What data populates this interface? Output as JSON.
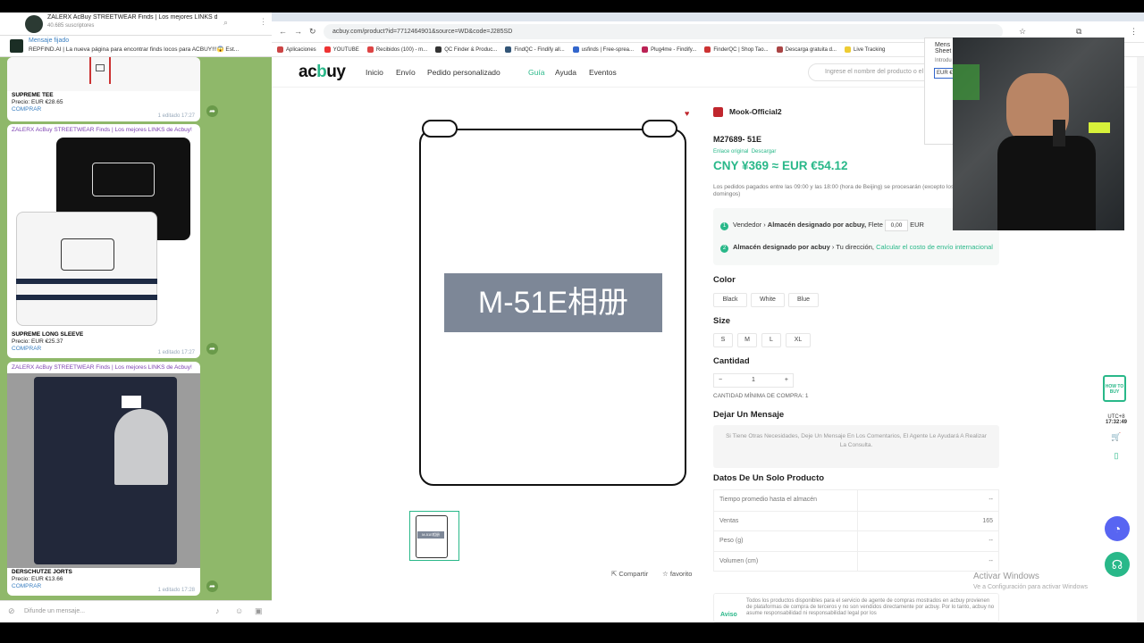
{
  "telegram": {
    "channel_title": "ZALERX AcBuy STREETWEAR Finds | Los mejores LINKS de AC...",
    "subscribers": "40.685 suscriptores",
    "pinned_label": "Mensaje fijado",
    "pinned_text": "REPFIND.AI | La nueva página para encontrar finds locos para ACBUY!!!😱 Est...",
    "messages": [
      {
        "source": "",
        "name": "SUPREME TEE",
        "price": "Precio: EUR €28.65",
        "link": "COMPRAR",
        "meta": "1  editado 17:27"
      },
      {
        "source": "ZALERX AcBuy STREETWEAR Finds | Los mejores LINKS de Acbuy!",
        "name": "SUPREME LONG SLEEVE",
        "price": "Precio: EUR €25.37",
        "link": "COMPRAR",
        "meta": "1  editado 17:27"
      },
      {
        "source": "ZALERX AcBuy STREETWEAR Finds | Los mejores LINKS de Acbuy!",
        "name": "DERSCHUTZE JORTS",
        "price": "Precio: EUR €13.66",
        "link": "COMPRAR",
        "meta": "1  editado 17:28"
      }
    ],
    "input_placeholder": "Difunde un mensaje..."
  },
  "browser": {
    "url": "acbuy.com/product?id=771246490​1&source=WD&code=J285SD",
    "bookmarks": [
      "Aplicaciones",
      "YOUTUBE",
      "Recibidos (100) - m...",
      "QC Finder & Produc...",
      "FindQC - Findify all...",
      "usfinds | Free-sprea...",
      "Plug4me - Findify...",
      "FinderQC | Shop Tao...",
      "Descarga gratuita d...",
      "Live Tracking"
    ],
    "colors": {
      "accent": "#29b889",
      "shop_icon": "#c0262d"
    }
  },
  "site": {
    "logo_a": "ac",
    "logo_b": "b",
    "logo_c": "uy",
    "nav": [
      "Inicio",
      "Envío",
      "Pedido personalizado",
      "Guía",
      "Ayuda",
      "Eventos"
    ],
    "search_placeholder": "Ingrese el nombre del producto o el",
    "image_text": "M-51E相册",
    "thumb_text": "M-51E相册",
    "share": "Compartir",
    "favorite": "favorito",
    "shop_name": "Mook-Official2",
    "product_code": "M27689- 51E",
    "original_link": "Enlace original",
    "download": "Descargar",
    "price": "CNY ¥369  ≈  EUR €54.12",
    "order_note": "Los pedidos pagados entre las 09:00 y las 18:00 (hora de Beijing) se procesarán (excepto los domingos)",
    "step1": {
      "from": "Vendedor",
      "to": "Almacén designado por acbuy,",
      "flete": "Flete",
      "value": "0,00",
      "currency": "EUR"
    },
    "step2": {
      "from": "Almacén designado por acbuy",
      "to": "Tu dirección,",
      "link": "Calcular el costo de envío internacional"
    },
    "color_label": "Color",
    "colors": [
      "Black",
      "White",
      "Blue"
    ],
    "size_label": "Size",
    "sizes": [
      "S",
      "M",
      "L",
      "XL"
    ],
    "qty_label": "Cantidad",
    "qty_value": "1",
    "min_qty": "CANTIDAD MÍNIMA DE COMPRA: 1",
    "message_label": "Dejar Un Mensaje",
    "message_placeholder": "Si Tiene Otras Necesidades, Deje Un Mensaje En Los Comentarios, El Agente Le Ayudará A Realizar La Consulta.",
    "data_label": "Datos De Un Solo Producto",
    "data_rows": [
      {
        "k": "Tiempo promedio hasta el almacén",
        "v": "--"
      },
      {
        "k": "Ventas",
        "v": "165"
      },
      {
        "k": "Peso (g)",
        "v": "--"
      },
      {
        "k": "Volumen (cm)",
        "v": "--"
      }
    ],
    "aviso_label": "Aviso",
    "aviso_text": "Todos los productos disponibles para el servicio de agente de compras mostrados en acbuy provienen de plataformas de compra de terceros y no son vendidos directamente por acbuy. Por lo tanto, acbuy no asume responsabilidad ni responsabilidad legal por los",
    "rail_tz": "UTC+8",
    "rail_time": "17:32:49",
    "rail_badge": "HOW TO BUY",
    "dropdown_a": "Mens",
    "dropdown_b": "Sheet",
    "dropdown_c": "Introdu",
    "dropdown_d": "EUR €",
    "activate_title": "Activar Windows",
    "activate_sub": "Ve a Configuración para activar Windows"
  }
}
